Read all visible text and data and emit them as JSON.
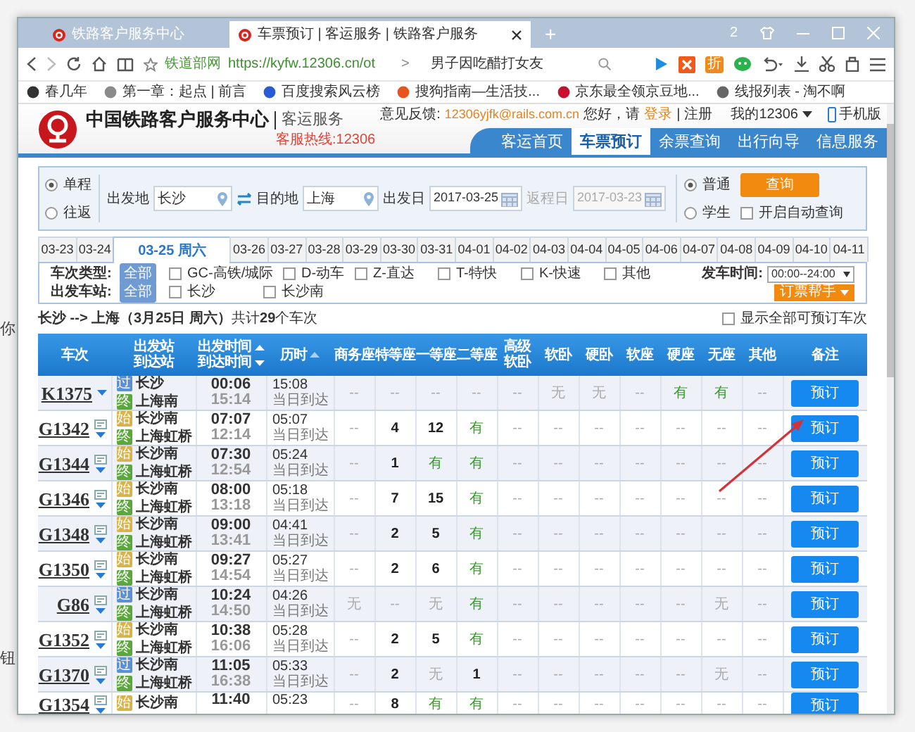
{
  "background_texts": [
    "你",
    "钮"
  ],
  "browser": {
    "tabs": [
      {
        "title": "铁路客户服务中心",
        "selected": false
      },
      {
        "title": "车票预订 | 客运服务 | 铁路客户服务",
        "selected": true
      }
    ],
    "new_tab": "+",
    "window_count": "2",
    "site_label": "铁道部网",
    "url": "https://kyfw.12306.cn/ot",
    "url_more": ">",
    "search_text": "男子因吃醋打女友",
    "deal_label": "折",
    "bookmarks": [
      {
        "title": "春几年",
        "color": "#333333"
      },
      {
        "title": "第一章：起点 | 前言",
        "color": "#8a8a8a"
      },
      {
        "title": "百度搜索风云榜",
        "color": "#2a5bd7"
      },
      {
        "title": "搜狗指南—生活技...",
        "color": "#e8541e"
      },
      {
        "title": "京东最全领京豆地...",
        "color": "#c8102e"
      },
      {
        "title": "线报列表 - 淘不啊",
        "color": "#666666"
      }
    ]
  },
  "site": {
    "title": "中国铁路客户服务中心",
    "subtitle": "客运服务",
    "hotline": "客服热线:12306",
    "feedback_label": "意见反馈:",
    "feedback_email": "12306yjfk@rails.com.cn",
    "greeting": "您好，请",
    "login": "登录",
    "separator": "|",
    "register": "注册",
    "my_account": "我的12306",
    "mobile": "手机版",
    "nav": [
      {
        "label": "客运首页",
        "selected": false
      },
      {
        "label": "车票预订",
        "selected": true
      },
      {
        "label": "余票查询",
        "selected": false
      },
      {
        "label": "出行向导",
        "selected": false
      },
      {
        "label": "信息服务",
        "selected": false
      }
    ]
  },
  "search": {
    "trip_types": [
      {
        "label": "单程",
        "selected": true
      },
      {
        "label": "往返",
        "selected": false
      }
    ],
    "from_label": "出发地",
    "from": "长沙",
    "to_label": "目的地",
    "to": "上海",
    "date_label": "出发日",
    "date": "2017-03-25",
    "return_label": "返程日",
    "return_date": "2017-03-23",
    "return_disabled": true,
    "passenger_types": [
      {
        "label": "普通",
        "selected": true
      },
      {
        "label": "学生",
        "selected": false
      }
    ],
    "query_button": "查询",
    "auto_query": {
      "label": "开启自动查询",
      "checked": false
    }
  },
  "dates": [
    {
      "label": "03-23",
      "selected": false
    },
    {
      "label": "03-24",
      "selected": false
    },
    {
      "label": "03-25 周六",
      "selected": true
    },
    {
      "label": "03-26",
      "selected": false
    },
    {
      "label": "03-27",
      "selected": false
    },
    {
      "label": "03-28",
      "selected": false
    },
    {
      "label": "03-29",
      "selected": false
    },
    {
      "label": "03-30",
      "selected": false
    },
    {
      "label": "03-31",
      "selected": false
    },
    {
      "label": "04-01",
      "selected": false
    },
    {
      "label": "04-02",
      "selected": false
    },
    {
      "label": "04-03",
      "selected": false
    },
    {
      "label": "04-04",
      "selected": false
    },
    {
      "label": "04-05",
      "selected": false
    },
    {
      "label": "04-06",
      "selected": false
    },
    {
      "label": "04-07",
      "selected": false
    },
    {
      "label": "04-08",
      "selected": false
    },
    {
      "label": "04-09",
      "selected": false
    },
    {
      "label": "04-10",
      "selected": false
    },
    {
      "label": "04-11",
      "selected": false
    }
  ],
  "filters": {
    "type_label": "车次类型:",
    "type_all": "全部",
    "types": [
      {
        "label": "GC-高铁/城际",
        "checked": false
      },
      {
        "label": "D-动车",
        "checked": false
      },
      {
        "label": "Z-直达",
        "checked": false
      },
      {
        "label": "T-特快",
        "checked": false
      },
      {
        "label": "K-快速",
        "checked": false
      },
      {
        "label": "其他",
        "checked": false
      }
    ],
    "time_label": "发车时间:",
    "time_value": "00:00--24:00",
    "station_label": "出发车站:",
    "station_all": "全部",
    "stations": [
      {
        "label": "长沙",
        "checked": false
      },
      {
        "label": "长沙南",
        "checked": false
      }
    ],
    "helper": "订票帮手"
  },
  "summary": "**长沙 --> 上海（3月25日  周六）**共计**29**个车次",
  "show_all": {
    "label": "显示全部可预订车次",
    "checked": false
  },
  "table": {
    "columns": [
      {
        "lines": [
          "车次"
        ]
      },
      {
        "lines": [
          "出发站",
          "到达站"
        ]
      },
      {
        "lines": [
          "出发时间",
          "到达时间"
        ],
        "sortable": true
      },
      {
        "lines": [
          "历时"
        ],
        "sortable": true
      },
      {
        "lines": [
          "商务座"
        ]
      },
      {
        "lines": [
          "特等座"
        ]
      },
      {
        "lines": [
          "一等座"
        ]
      },
      {
        "lines": [
          "二等座"
        ]
      },
      {
        "lines": [
          "高级",
          "软卧"
        ]
      },
      {
        "lines": [
          "软卧"
        ]
      },
      {
        "lines": [
          "硬卧"
        ]
      },
      {
        "lines": [
          "软座"
        ]
      },
      {
        "lines": [
          "硬座"
        ]
      },
      {
        "lines": [
          "无座"
        ]
      },
      {
        "lines": [
          "其他"
        ]
      },
      {
        "lines": [
          "备注"
        ]
      }
    ],
    "rows": [
      {
        "train": "K1375",
        "info_icon": false,
        "stations": [
          {
            "badge": "过",
            "name": "长沙",
            "color": "#5b8fd6"
          },
          {
            "badge": "终",
            "name": "上海南",
            "color": "#5aa83b"
          }
        ],
        "depart": "00:06",
        "arrive": "15:14",
        "duration": "15:08",
        "arrival_day": "当日到达",
        "button": "预订",
        "seats": [
          {
            "text": "--",
            "kind": "na"
          },
          {
            "text": "--",
            "kind": "na"
          },
          {
            "text": "--",
            "kind": "na"
          },
          {
            "text": "--",
            "kind": "na"
          },
          {
            "text": "--",
            "kind": "na"
          },
          {
            "text": "无",
            "kind": "none"
          },
          {
            "text": "无",
            "kind": "none"
          },
          {
            "text": "--",
            "kind": "na"
          },
          {
            "text": "有",
            "kind": "available"
          },
          {
            "text": "有",
            "kind": "available"
          },
          {
            "text": "--",
            "kind": "na"
          }
        ]
      },
      {
        "train": "G1342",
        "info_icon": true,
        "stations": [
          {
            "badge": "始",
            "name": "长沙南",
            "color": "#d9b34a"
          },
          {
            "badge": "终",
            "name": "上海虹桥",
            "color": "#5aa83b"
          }
        ],
        "depart": "07:07",
        "arrive": "12:14",
        "duration": "05:07",
        "arrival_day": "当日到达",
        "button": "预订",
        "seats": [
          {
            "text": "--",
            "kind": "na"
          },
          {
            "text": "4",
            "kind": "count"
          },
          {
            "text": "12",
            "kind": "count"
          },
          {
            "text": "有",
            "kind": "available"
          },
          {
            "text": "--",
            "kind": "na"
          },
          {
            "text": "--",
            "kind": "na"
          },
          {
            "text": "--",
            "kind": "na"
          },
          {
            "text": "--",
            "kind": "na"
          },
          {
            "text": "--",
            "kind": "na"
          },
          {
            "text": "--",
            "kind": "na"
          },
          {
            "text": "--",
            "kind": "na"
          }
        ]
      },
      {
        "train": "G1344",
        "info_icon": true,
        "stations": [
          {
            "badge": "始",
            "name": "长沙南",
            "color": "#d9b34a"
          },
          {
            "badge": "终",
            "name": "上海虹桥",
            "color": "#5aa83b"
          }
        ],
        "depart": "07:30",
        "arrive": "12:54",
        "duration": "05:24",
        "arrival_day": "当日到达",
        "button": "预订",
        "seats": [
          {
            "text": "--",
            "kind": "na"
          },
          {
            "text": "1",
            "kind": "count"
          },
          {
            "text": "有",
            "kind": "available"
          },
          {
            "text": "有",
            "kind": "available"
          },
          {
            "text": "--",
            "kind": "na"
          },
          {
            "text": "--",
            "kind": "na"
          },
          {
            "text": "--",
            "kind": "na"
          },
          {
            "text": "--",
            "kind": "na"
          },
          {
            "text": "--",
            "kind": "na"
          },
          {
            "text": "--",
            "kind": "na"
          },
          {
            "text": "--",
            "kind": "na"
          }
        ]
      },
      {
        "train": "G1346",
        "info_icon": true,
        "stations": [
          {
            "badge": "始",
            "name": "长沙南",
            "color": "#d9b34a"
          },
          {
            "badge": "终",
            "name": "上海虹桥",
            "color": "#5aa83b"
          }
        ],
        "depart": "08:00",
        "arrive": "13:18",
        "duration": "05:18",
        "arrival_day": "当日到达",
        "button": "预订",
        "seats": [
          {
            "text": "--",
            "kind": "na"
          },
          {
            "text": "7",
            "kind": "count"
          },
          {
            "text": "15",
            "kind": "count"
          },
          {
            "text": "有",
            "kind": "available"
          },
          {
            "text": "--",
            "kind": "na"
          },
          {
            "text": "--",
            "kind": "na"
          },
          {
            "text": "--",
            "kind": "na"
          },
          {
            "text": "--",
            "kind": "na"
          },
          {
            "text": "--",
            "kind": "na"
          },
          {
            "text": "--",
            "kind": "na"
          },
          {
            "text": "--",
            "kind": "na"
          }
        ]
      },
      {
        "train": "G1348",
        "info_icon": true,
        "stations": [
          {
            "badge": "始",
            "name": "长沙南",
            "color": "#d9b34a"
          },
          {
            "badge": "终",
            "name": "上海虹桥",
            "color": "#5aa83b"
          }
        ],
        "depart": "09:00",
        "arrive": "13:41",
        "duration": "04:41",
        "arrival_day": "当日到达",
        "button": "预订",
        "seats": [
          {
            "text": "--",
            "kind": "na"
          },
          {
            "text": "2",
            "kind": "count"
          },
          {
            "text": "5",
            "kind": "count"
          },
          {
            "text": "有",
            "kind": "available"
          },
          {
            "text": "--",
            "kind": "na"
          },
          {
            "text": "--",
            "kind": "na"
          },
          {
            "text": "--",
            "kind": "na"
          },
          {
            "text": "--",
            "kind": "na"
          },
          {
            "text": "--",
            "kind": "na"
          },
          {
            "text": "--",
            "kind": "na"
          },
          {
            "text": "--",
            "kind": "na"
          }
        ]
      },
      {
        "train": "G1350",
        "info_icon": true,
        "stations": [
          {
            "badge": "始",
            "name": "长沙南",
            "color": "#d9b34a"
          },
          {
            "badge": "终",
            "name": "上海虹桥",
            "color": "#5aa83b"
          }
        ],
        "depart": "09:27",
        "arrive": "14:54",
        "duration": "05:27",
        "arrival_day": "当日到达",
        "button": "预订",
        "seats": [
          {
            "text": "--",
            "kind": "na"
          },
          {
            "text": "2",
            "kind": "count"
          },
          {
            "text": "6",
            "kind": "count"
          },
          {
            "text": "有",
            "kind": "available"
          },
          {
            "text": "--",
            "kind": "na"
          },
          {
            "text": "--",
            "kind": "na"
          },
          {
            "text": "--",
            "kind": "na"
          },
          {
            "text": "--",
            "kind": "na"
          },
          {
            "text": "--",
            "kind": "na"
          },
          {
            "text": "--",
            "kind": "na"
          },
          {
            "text": "--",
            "kind": "na"
          }
        ]
      },
      {
        "train": "G86",
        "info_icon": true,
        "stations": [
          {
            "badge": "过",
            "name": "长沙南",
            "color": "#5b8fd6"
          },
          {
            "badge": "终",
            "name": "上海虹桥",
            "color": "#5aa83b"
          }
        ],
        "depart": "10:24",
        "arrive": "14:50",
        "duration": "04:26",
        "arrival_day": "当日到达",
        "button": "预订",
        "seats": [
          {
            "text": "无",
            "kind": "none"
          },
          {
            "text": "--",
            "kind": "na"
          },
          {
            "text": "无",
            "kind": "none"
          },
          {
            "text": "有",
            "kind": "available"
          },
          {
            "text": "--",
            "kind": "na"
          },
          {
            "text": "--",
            "kind": "na"
          },
          {
            "text": "--",
            "kind": "na"
          },
          {
            "text": "--",
            "kind": "na"
          },
          {
            "text": "--",
            "kind": "na"
          },
          {
            "text": "无",
            "kind": "none"
          },
          {
            "text": "--",
            "kind": "na"
          }
        ]
      },
      {
        "train": "G1352",
        "info_icon": true,
        "stations": [
          {
            "badge": "始",
            "name": "长沙南",
            "color": "#d9b34a"
          },
          {
            "badge": "终",
            "name": "上海虹桥",
            "color": "#5aa83b"
          }
        ],
        "depart": "10:38",
        "arrive": "16:06",
        "duration": "05:28",
        "arrival_day": "当日到达",
        "button": "预订",
        "seats": [
          {
            "text": "--",
            "kind": "na"
          },
          {
            "text": "2",
            "kind": "count"
          },
          {
            "text": "5",
            "kind": "count"
          },
          {
            "text": "有",
            "kind": "available"
          },
          {
            "text": "--",
            "kind": "na"
          },
          {
            "text": "--",
            "kind": "na"
          },
          {
            "text": "--",
            "kind": "na"
          },
          {
            "text": "--",
            "kind": "na"
          },
          {
            "text": "--",
            "kind": "na"
          },
          {
            "text": "--",
            "kind": "na"
          },
          {
            "text": "--",
            "kind": "na"
          }
        ]
      },
      {
        "train": "G1370",
        "info_icon": true,
        "stations": [
          {
            "badge": "过",
            "name": "长沙南",
            "color": "#5b8fd6"
          },
          {
            "badge": "终",
            "name": "上海虹桥",
            "color": "#5aa83b"
          }
        ],
        "depart": "11:05",
        "arrive": "16:38",
        "duration": "05:33",
        "arrival_day": "当日到达",
        "button": "预订",
        "seats": [
          {
            "text": "--",
            "kind": "na"
          },
          {
            "text": "2",
            "kind": "count"
          },
          {
            "text": "无",
            "kind": "none"
          },
          {
            "text": "1",
            "kind": "count"
          },
          {
            "text": "--",
            "kind": "na"
          },
          {
            "text": "--",
            "kind": "na"
          },
          {
            "text": "--",
            "kind": "na"
          },
          {
            "text": "--",
            "kind": "na"
          },
          {
            "text": "--",
            "kind": "na"
          },
          {
            "text": "无",
            "kind": "none"
          },
          {
            "text": "--",
            "kind": "na"
          }
        ]
      },
      {
        "train": "G1354",
        "info_icon": true,
        "stations": [
          {
            "badge": "始",
            "name": "长沙南",
            "color": "#d9b34a"
          }
        ],
        "depart": "11:40",
        "duration": "05:23",
        "button": "预订",
        "seats": [
          {
            "text": "--",
            "kind": "na"
          },
          {
            "text": "8",
            "kind": "count"
          },
          {
            "text": "有",
            "kind": "available"
          },
          {
            "text": "有",
            "kind": "available"
          },
          {
            "text": "--",
            "kind": "na"
          },
          {
            "text": "--",
            "kind": "na"
          },
          {
            "text": "--",
            "kind": "na"
          },
          {
            "text": "--",
            "kind": "na"
          },
          {
            "text": "--",
            "kind": "na"
          },
          {
            "text": "--",
            "kind": "na"
          },
          {
            "text": "--",
            "kind": "na"
          }
        ]
      }
    ]
  }
}
